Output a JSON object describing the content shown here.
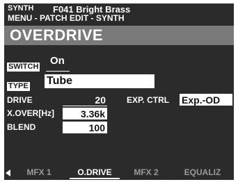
{
  "header": {
    "mode": "SYNTH",
    "patch": "F041 Bright Brass",
    "path": "MENU - PATCH EDIT - SYNTH"
  },
  "page": {
    "title": "OVERDRIVE"
  },
  "switch": {
    "label": "SWITCH",
    "value": "On"
  },
  "type": {
    "label": "TYPE",
    "value": "Tube"
  },
  "params": {
    "drive": {
      "label": "DRIVE",
      "value": "20"
    },
    "xover": {
      "label": "X.OVER[Hz]",
      "value": "3.36k"
    },
    "blend": {
      "label": "BLEND",
      "value": "100"
    },
    "exp_ctrl": {
      "label": "EXP. CTRL",
      "value": "Exp.-OD"
    }
  },
  "tabs": [
    {
      "label": "MFX 1",
      "active": false
    },
    {
      "label": "O.DRIVE",
      "active": true
    },
    {
      "label": "MFX 2",
      "active": false
    },
    {
      "label": "EQUALIZ",
      "active": false
    }
  ],
  "icons": {
    "left": "left-arrow-icon"
  },
  "colors": {
    "lcd_bg": "#2b2b2b",
    "title_bar": "#7a7a7a",
    "inactive_tab": "#9a9a9a"
  }
}
